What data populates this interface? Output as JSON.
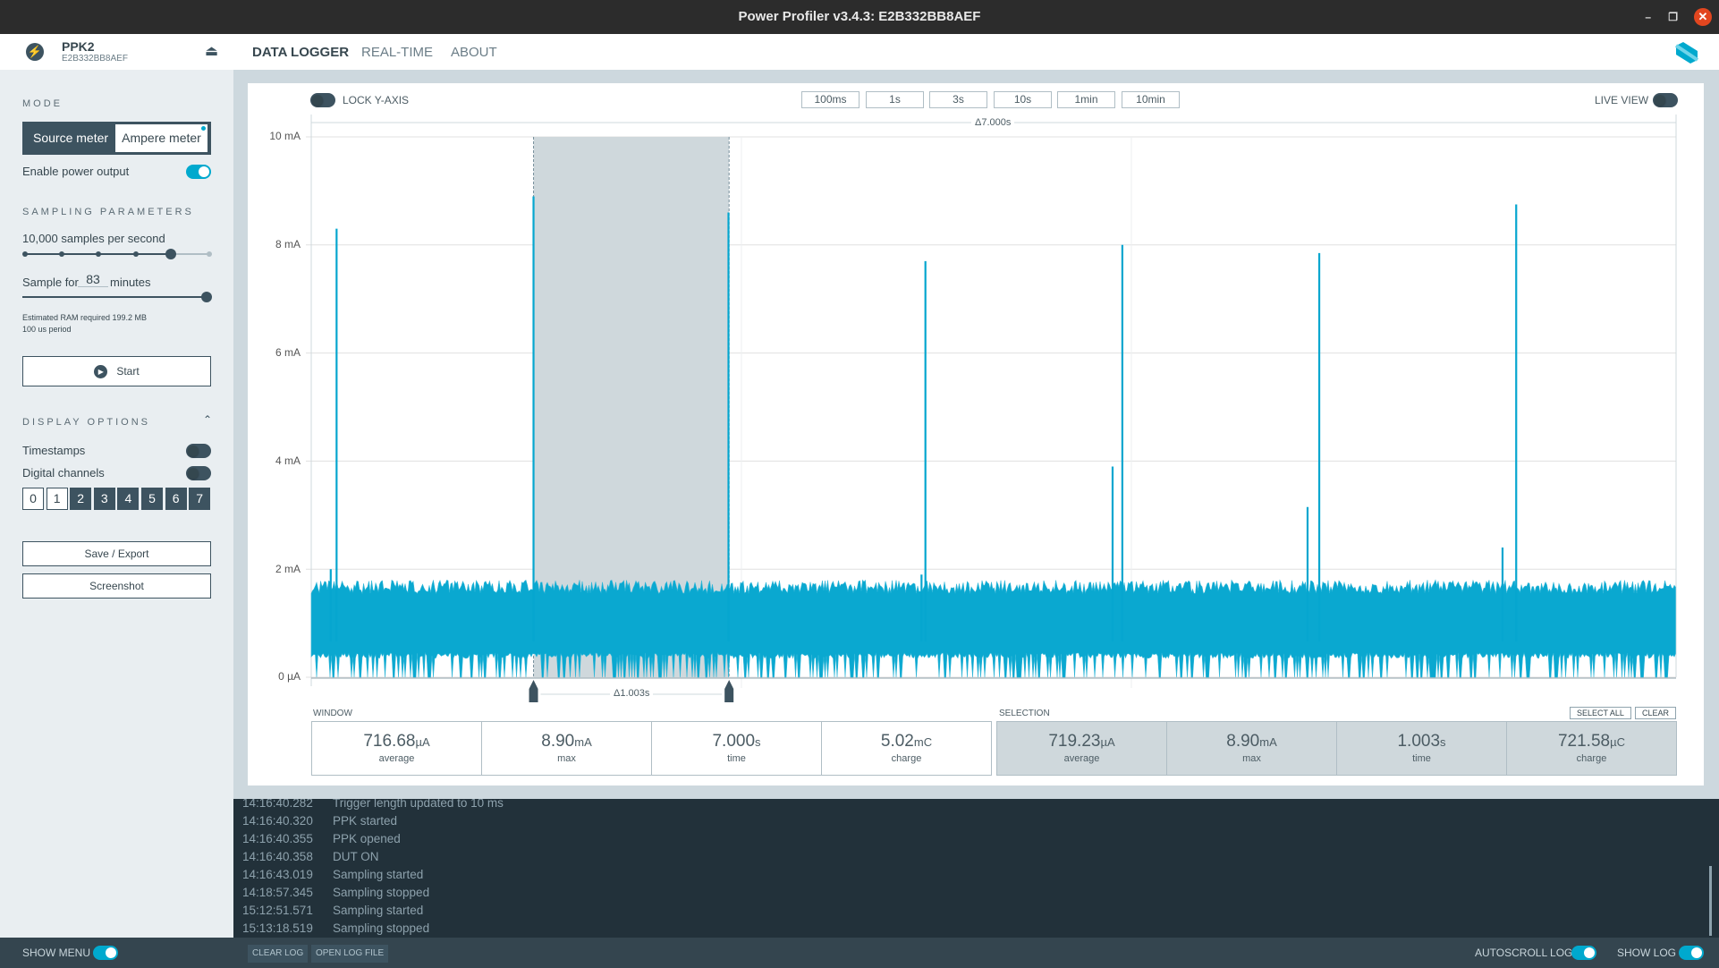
{
  "window": {
    "title": "Power Profiler v3.4.3: E2B332BB8AEF",
    "minimize": "–",
    "maximize": "❐",
    "close": "✕"
  },
  "header": {
    "device_name": "PPK2",
    "device_serial": "E2B332BB8AEF",
    "tabs": [
      {
        "label": "DATA LOGGER",
        "active": true
      },
      {
        "label": "REAL-TIME",
        "active": false
      },
      {
        "label": "ABOUT",
        "active": false
      }
    ],
    "accent": "#00a9ce"
  },
  "sidebar": {
    "mode_title": "MODE",
    "mode_options": [
      "Source meter",
      "Ampere meter"
    ],
    "mode_selected": "Ampere meter",
    "enable_power_output": "Enable power output",
    "enable_power_output_on": true,
    "sampling_title": "SAMPLING PARAMETERS",
    "sample_rate": "10,000 samples per second",
    "sample_rate_step": 5,
    "sample_rate_steps": 6,
    "sample_for_label": "Sample for",
    "sample_for_value": "83",
    "sample_for_unit": "minutes",
    "duration_fraction": 1.0,
    "ram_estimate": "Estimated RAM required 199.2 MB",
    "period": "100 us period",
    "start_label": "Start",
    "display_title": "DISPLAY OPTIONS",
    "timestamps": "Timestamps",
    "timestamps_on": false,
    "digital_channels": "Digital channels",
    "digital_channels_on": false,
    "channels": [
      {
        "label": "0",
        "on": false
      },
      {
        "label": "1",
        "on": false
      },
      {
        "label": "2",
        "on": true
      },
      {
        "label": "3",
        "on": true
      },
      {
        "label": "4",
        "on": true
      },
      {
        "label": "5",
        "on": true
      },
      {
        "label": "6",
        "on": true
      },
      {
        "label": "7",
        "on": true
      }
    ],
    "save_export": "Save / Export",
    "screenshot": "Screenshot"
  },
  "chart": {
    "lock_y_axis": "LOCK Y-AXIS",
    "lock_y_axis_on": false,
    "time_buttons": [
      "100ms",
      "1s",
      "3s",
      "10s",
      "1min",
      "10min"
    ],
    "live_view": "LIVE VIEW",
    "live_view_on": false,
    "window_delta": "Δ7.000s",
    "selection_delta": "Δ1.003s"
  },
  "chart_data": {
    "type": "line",
    "ylim_mA": [
      0,
      10
    ],
    "xlim_s": [
      0,
      7
    ],
    "y_ticks": [
      "10 mA",
      "8 mA",
      "6 mA",
      "4 mA",
      "2 mA",
      "0 µA"
    ],
    "grid": true,
    "series_color": "#00a9ce",
    "baseline_range_mA": [
      0,
      1.7
    ],
    "spikes": [
      {
        "t": 0.13,
        "mA": 8.3
      },
      {
        "t": 1.14,
        "mA": 8.9
      },
      {
        "t": 2.14,
        "mA": 8.6
      },
      {
        "t": 3.15,
        "mA": 7.7
      },
      {
        "t": 4.16,
        "mA": 8.0
      },
      {
        "t": 5.17,
        "mA": 7.85
      },
      {
        "t": 6.18,
        "mA": 8.75
      },
      {
        "t": 0.1,
        "mA": 2.0
      },
      {
        "t": 3.13,
        "mA": 1.9
      },
      {
        "t": 4.11,
        "mA": 3.9
      },
      {
        "t": 5.11,
        "mA": 3.15
      },
      {
        "t": 6.11,
        "mA": 2.4
      }
    ],
    "selection_s": [
      1.14,
      2.143
    ]
  },
  "window_stats": {
    "label": "WINDOW",
    "items": [
      {
        "value": "716.68",
        "unit": "µA",
        "caption": "average"
      },
      {
        "value": "8.90",
        "unit": "mA",
        "caption": "max"
      },
      {
        "value": "7.000",
        "unit": "s",
        "caption": "time"
      },
      {
        "value": "5.02",
        "unit": "mC",
        "caption": "charge"
      }
    ]
  },
  "selection_stats": {
    "label": "SELECTION",
    "select_all": "SELECT ALL",
    "clear": "CLEAR",
    "items": [
      {
        "value": "719.23",
        "unit": "µA",
        "caption": "average"
      },
      {
        "value": "8.90",
        "unit": "mA",
        "caption": "max"
      },
      {
        "value": "1.003",
        "unit": "s",
        "caption": "time"
      },
      {
        "value": "721.58",
        "unit": "µC",
        "caption": "charge"
      }
    ]
  },
  "log": [
    {
      "time": "14:16:40.282",
      "msg": "Trigger length updated to 10 ms"
    },
    {
      "time": "14:16:40.320",
      "msg": "PPK started"
    },
    {
      "time": "14:16:40.355",
      "msg": "PPK opened"
    },
    {
      "time": "14:16:40.358",
      "msg": "DUT ON"
    },
    {
      "time": "14:16:43.019",
      "msg": "Sampling started"
    },
    {
      "time": "14:18:57.345",
      "msg": "Sampling stopped"
    },
    {
      "time": "15:12:51.571",
      "msg": "Sampling started"
    },
    {
      "time": "15:13:18.519",
      "msg": "Sampling stopped"
    }
  ],
  "bottom": {
    "show_menu": "SHOW MENU",
    "show_menu_on": true,
    "clear_log": "CLEAR LOG",
    "open_log_file": "OPEN LOG FILE",
    "autoscroll_log": "AUTOSCROLL LOG",
    "autoscroll_on": true,
    "show_log": "SHOW LOG",
    "show_log_on": true
  }
}
